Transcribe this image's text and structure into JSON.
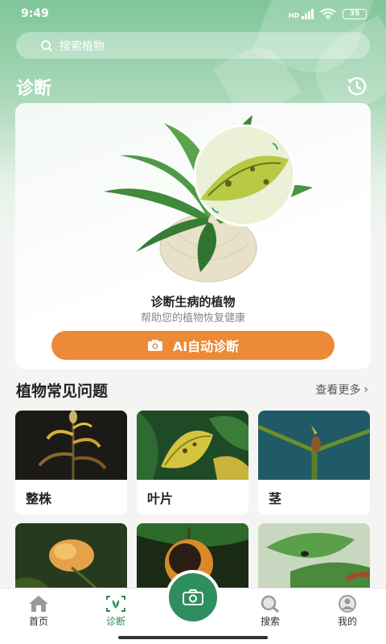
{
  "status": {
    "time": "9:49",
    "battery": "35",
    "network": "HD"
  },
  "search": {
    "placeholder": "搜索植物"
  },
  "diagnose": {
    "section_title": "诊断",
    "card_title": "诊断生病的植物",
    "card_subtitle": "帮助您的植物恢复健康",
    "button_label": "AI自动诊断"
  },
  "problems": {
    "title": "植物常见问题",
    "see_more": "查看更多",
    "items": [
      {
        "label": "整株"
      },
      {
        "label": "叶片"
      },
      {
        "label": "茎"
      }
    ]
  },
  "nav": {
    "items": [
      {
        "label": "首页",
        "icon": "home-icon"
      },
      {
        "label": "诊断",
        "icon": "scan-plant-icon"
      },
      {
        "label": "搜索",
        "icon": "search-icon"
      },
      {
        "label": "我的",
        "icon": "profile-icon"
      }
    ],
    "active": "诊断"
  },
  "colors": {
    "accent": "#2f8e5d",
    "button": "#ec8a37",
    "header": "#7fc699"
  }
}
